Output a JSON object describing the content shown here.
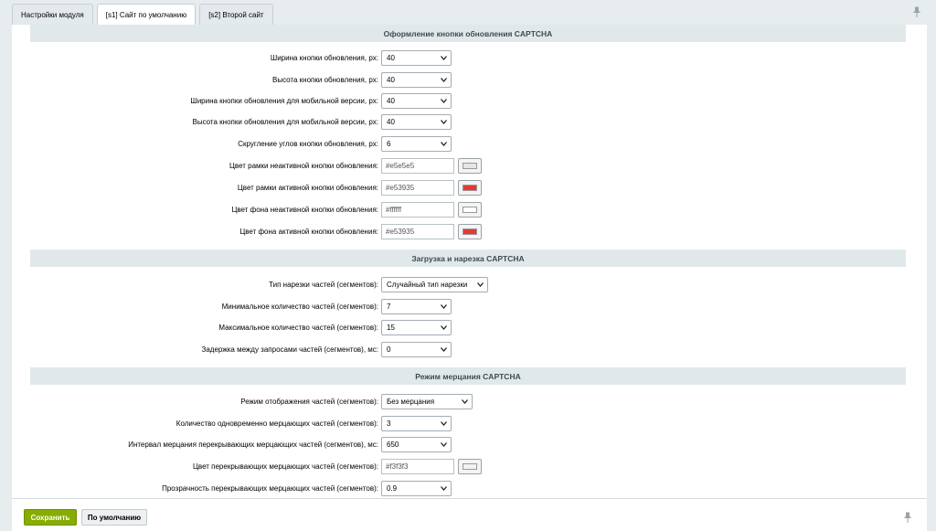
{
  "tabs": [
    {
      "label": "Настройки модуля"
    },
    {
      "label": "[s1] Сайт по умолчанию"
    },
    {
      "label": "[s2] Второй сайт"
    }
  ],
  "sections": [
    {
      "title": "Оформление кнопки обновления CAPTCHA"
    },
    {
      "title": "Загрузка и нарезка CAPTCHA"
    },
    {
      "title": "Режим мерцания CAPTCHA"
    }
  ],
  "fields": [
    {
      "label": "Ширина кнопки обновления, px:",
      "value": "40"
    },
    {
      "label": "Высота кнопки обновления, px:",
      "value": "40"
    },
    {
      "label": "Ширина кнопки обновления для мобильной версии, px:",
      "value": "40"
    },
    {
      "label": "Высота кнопки обновления для мобильной версии, px:",
      "value": "40"
    },
    {
      "label": "Скругление углов кнопки обновления, px:",
      "value": "6"
    },
    {
      "label": "Цвет рамки неактивной кнопки обновления:",
      "value": "#e5e5e5",
      "color": "#e5e5e5"
    },
    {
      "label": "Цвет рамки активной кнопки обновления:",
      "value": "#e53935",
      "color": "#e53935"
    },
    {
      "label": "Цвет фона неактивной кнопки обновления:",
      "value": "#ffffff",
      "color": "#ffffff"
    },
    {
      "label": "Цвет фона активной кнопки обновления:",
      "value": "#e53935",
      "color": "#e53935"
    },
    {
      "label": "Тип нарезки частей (сегментов):",
      "value": "Случайный тип нарезки"
    },
    {
      "label": "Минимальное количество частей (сегментов):",
      "value": "7"
    },
    {
      "label": "Максимальное количество частей (сегментов):",
      "value": "15"
    },
    {
      "label": "Задержка между запросами частей (сегментов), мс:",
      "value": "0"
    },
    {
      "label": "Режим отображения частей (сегментов):",
      "value": "Без мерцания"
    },
    {
      "label": "Количество одновременно мерцающих частей (сегментов):",
      "value": "3"
    },
    {
      "label": "Интервал мерцания перекрывающих мерцающих частей (сегментов), мс:",
      "value": "650"
    },
    {
      "label": "Цвет перекрывающих мерцающих частей (сегментов):",
      "value": "#f3f3f3",
      "color": "#f3f3f3"
    },
    {
      "label": "Прозрачность перекрывающих мерцающих частей (сегментов):",
      "value": "0.9"
    }
  ],
  "footer": {
    "save_label": "Сохранить",
    "default_label": "По умолчанию"
  },
  "icons": {
    "pin": "pin-icon",
    "chevron": "chevron-down-icon"
  },
  "colors": {
    "save_button": "#86ad00",
    "section_header_bg": "#e0e8ea"
  }
}
